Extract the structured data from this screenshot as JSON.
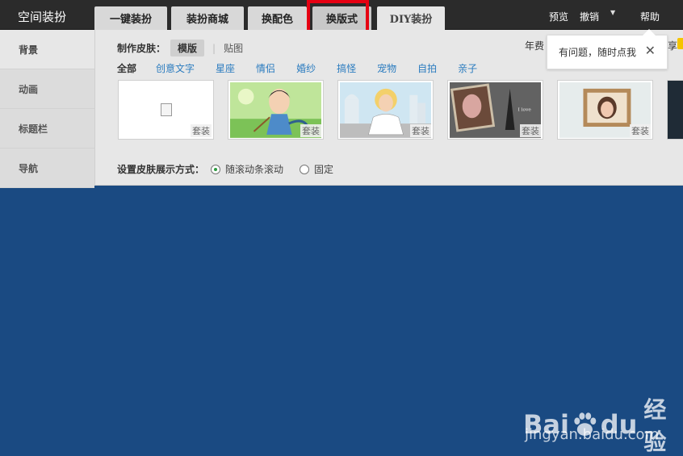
{
  "topbar": {
    "brand": "空间装扮",
    "tabs": [
      {
        "label": "一键装扮"
      },
      {
        "label": "装扮商城"
      },
      {
        "label": "换配色"
      },
      {
        "label": "换版式"
      },
      {
        "label": "DIY装扮"
      }
    ],
    "links": {
      "preview": "预览",
      "undo": "撤销",
      "help": "帮助"
    }
  },
  "sidebar": {
    "items": [
      {
        "label": "背景"
      },
      {
        "label": "动画"
      },
      {
        "label": "标题栏"
      },
      {
        "label": "导航"
      }
    ]
  },
  "skin": {
    "make_label": "制作皮肤：",
    "template_btn": "模版",
    "divider": "|",
    "sticker_btn": "贴图",
    "cut_left": "年费",
    "cut_right": "享"
  },
  "categories": [
    "全部",
    "创意文字",
    "星座",
    "情侣",
    "婚纱",
    "搞怪",
    "宠物",
    "自拍",
    "亲子"
  ],
  "thumbnails": [
    {
      "tag": "套装"
    },
    {
      "tag": "套装"
    },
    {
      "tag": "套装"
    },
    {
      "tag": "套装"
    },
    {
      "tag": "套装"
    }
  ],
  "display_mode": {
    "label": "设置皮肤展示方式：",
    "options": [
      {
        "label": "随滚动条滚动",
        "checked": true
      },
      {
        "label": "固定",
        "checked": false
      }
    ]
  },
  "tooltip": {
    "text": "有问题，随时点我",
    "close": "✕"
  },
  "watermark": {
    "logo_a": "Bai",
    "logo_b": "du",
    "logo_cn": "经验",
    "url": "jingyan.baidu.com"
  },
  "colors": {
    "page_bg": "#1a4a82",
    "topbar": "#2b2b2b",
    "highlight": "#e60012",
    "link": "#2a7bbf"
  }
}
